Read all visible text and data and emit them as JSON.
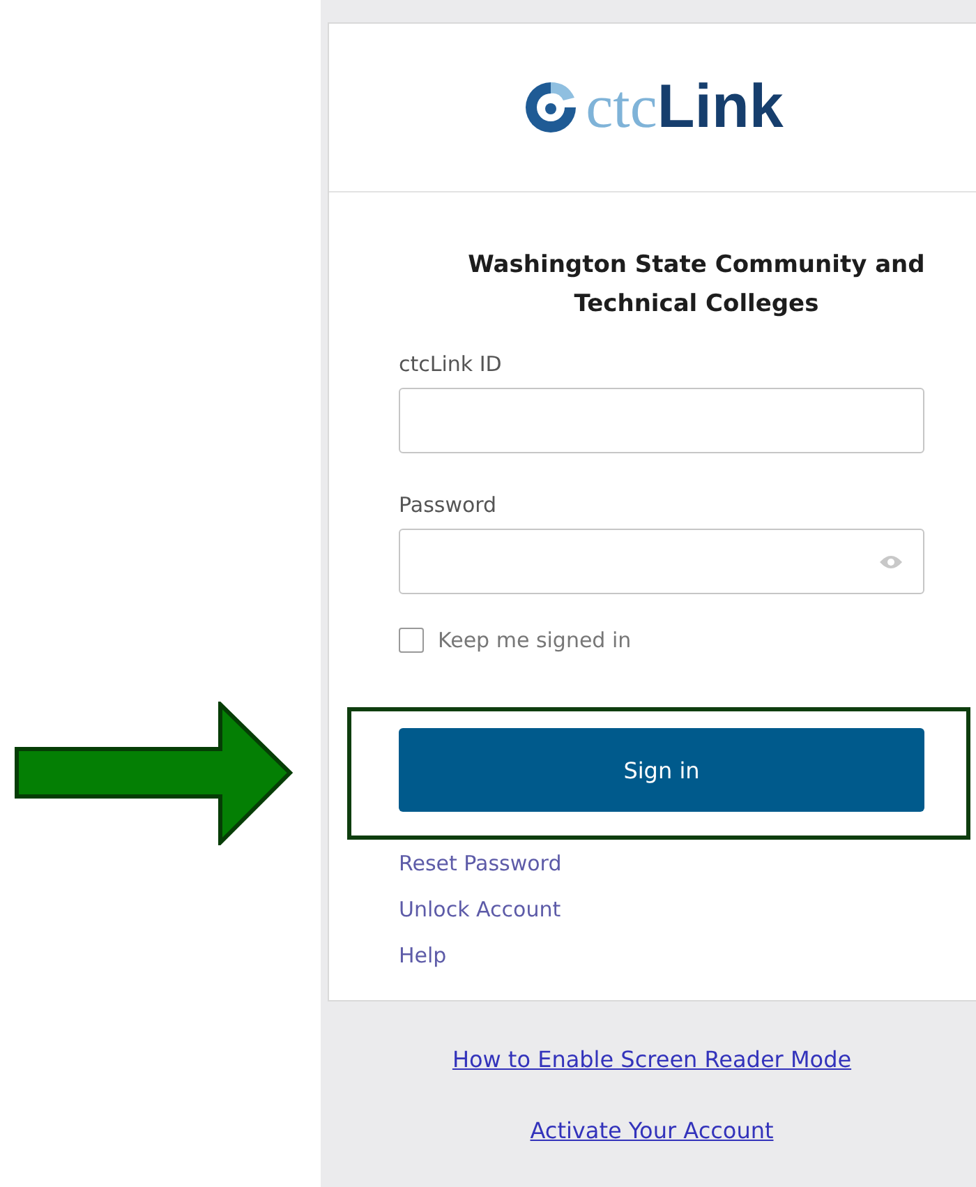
{
  "logo": {
    "light": "ctc",
    "bold": "Link"
  },
  "heading": "Washington State Community and Technical Colleges",
  "fields": [
    {
      "label": "ctcLink ID",
      "kind": "text"
    },
    {
      "label": "Password",
      "kind": "password"
    }
  ],
  "remember": {
    "label": "Keep me signed in",
    "checked": false
  },
  "sign_in_button": "Sign in",
  "links": [
    "Reset Password",
    "Unlock Account",
    "Help"
  ],
  "footer_links": [
    "How to Enable Screen Reader Mode",
    "Activate Your Account"
  ],
  "annotation": {
    "arrow": true,
    "highlight": true
  }
}
